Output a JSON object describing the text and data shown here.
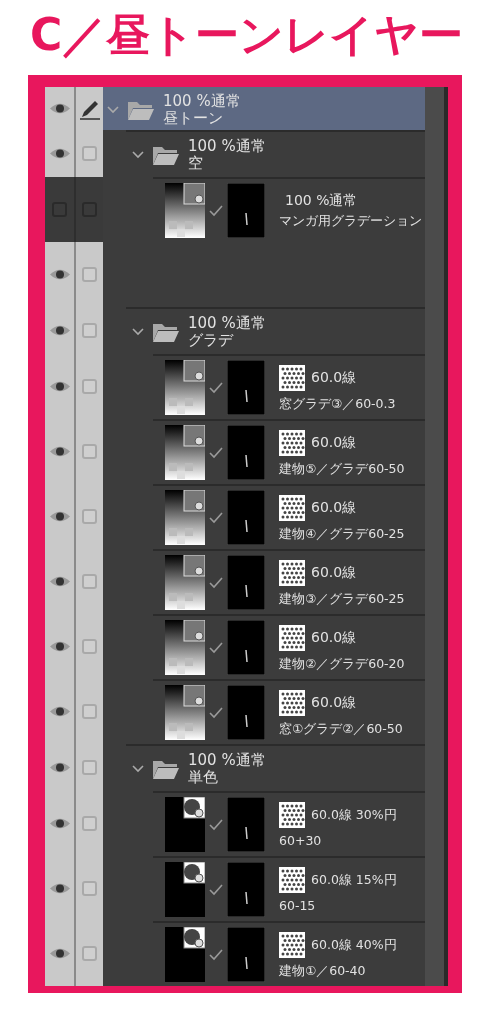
{
  "title": "C／昼トーンレイヤー",
  "layers": [
    {
      "kind": "folder",
      "mode": "100 %通常",
      "name": "昼トーン",
      "visible": true,
      "editing": true,
      "selected": true,
      "expanded": true,
      "children": [
        {
          "kind": "folder",
          "mode": "100 %通常",
          "name": "空",
          "visible": true,
          "editing": false,
          "selected": false,
          "expanded": true,
          "children": [
            {
              "kind": "gradient",
              "mode": "100 %通常",
              "name": "マンガ用グラデーション",
              "visible": false,
              "editing": false,
              "selected": false
            }
          ]
        },
        {
          "kind": "blank",
          "visible": true,
          "editing": false,
          "selected": false
        },
        {
          "kind": "folder",
          "mode": "100 %通常",
          "name": "グラデ",
          "visible": true,
          "editing": false,
          "selected": false,
          "expanded": true,
          "children": [
            {
              "kind": "gradient-tone",
              "tone": "60.0線",
              "name": "窓グラデ③／60-0.3",
              "visible": true,
              "editing": false,
              "selected": false
            },
            {
              "kind": "gradient-tone",
              "tone": "60.0線",
              "name": "建物⑤／グラデ60-50",
              "visible": true,
              "editing": false,
              "selected": false
            },
            {
              "kind": "gradient-tone",
              "tone": "60.0線",
              "name": "建物④／グラデ60-25",
              "visible": true,
              "editing": false,
              "selected": false
            },
            {
              "kind": "gradient-tone",
              "tone": "60.0線",
              "name": "建物③／グラデ60-25",
              "visible": true,
              "editing": false,
              "selected": false
            },
            {
              "kind": "gradient-tone",
              "tone": "60.0線",
              "name": "建物②／グラデ60-20",
              "visible": true,
              "editing": false,
              "selected": false
            },
            {
              "kind": "gradient-tone",
              "tone": "60.0線",
              "name": "窓①グラデ②／60-50",
              "visible": true,
              "editing": false,
              "selected": false
            }
          ]
        },
        {
          "kind": "folder",
          "mode": "100 %通常",
          "name": "単色",
          "visible": true,
          "editing": false,
          "selected": false,
          "expanded": true,
          "children": [
            {
              "kind": "solid-tone",
              "tone": "60.0線 30%円",
              "name": "60+30",
              "visible": true,
              "editing": false,
              "selected": false
            },
            {
              "kind": "solid-tone",
              "tone": "60.0線 15%円",
              "name": "60-15",
              "visible": true,
              "editing": false,
              "selected": false
            },
            {
              "kind": "solid-tone",
              "tone": "60.0線 40%円",
              "name": "建物①／60-40",
              "visible": true,
              "editing": false,
              "selected": false
            }
          ]
        }
      ]
    }
  ]
}
